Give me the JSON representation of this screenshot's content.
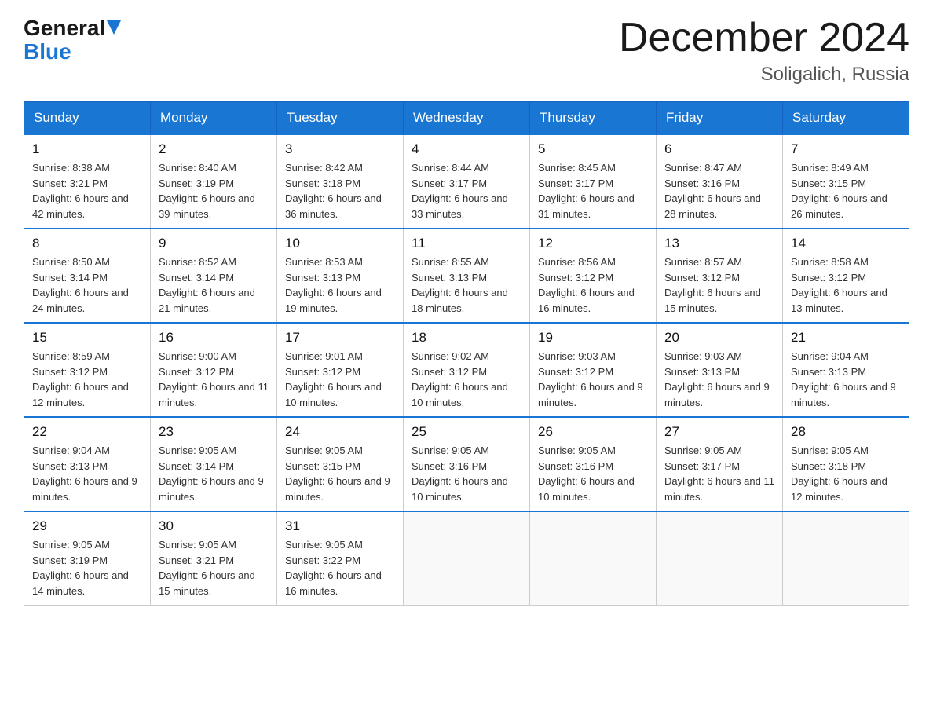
{
  "header": {
    "logo_general": "General",
    "logo_blue": "Blue",
    "month_title": "December 2024",
    "location": "Soligalich, Russia"
  },
  "days_of_week": [
    "Sunday",
    "Monday",
    "Tuesday",
    "Wednesday",
    "Thursday",
    "Friday",
    "Saturday"
  ],
  "weeks": [
    [
      {
        "day": "1",
        "sunrise": "Sunrise: 8:38 AM",
        "sunset": "Sunset: 3:21 PM",
        "daylight": "Daylight: 6 hours and 42 minutes."
      },
      {
        "day": "2",
        "sunrise": "Sunrise: 8:40 AM",
        "sunset": "Sunset: 3:19 PM",
        "daylight": "Daylight: 6 hours and 39 minutes."
      },
      {
        "day": "3",
        "sunrise": "Sunrise: 8:42 AM",
        "sunset": "Sunset: 3:18 PM",
        "daylight": "Daylight: 6 hours and 36 minutes."
      },
      {
        "day": "4",
        "sunrise": "Sunrise: 8:44 AM",
        "sunset": "Sunset: 3:17 PM",
        "daylight": "Daylight: 6 hours and 33 minutes."
      },
      {
        "day": "5",
        "sunrise": "Sunrise: 8:45 AM",
        "sunset": "Sunset: 3:17 PM",
        "daylight": "Daylight: 6 hours and 31 minutes."
      },
      {
        "day": "6",
        "sunrise": "Sunrise: 8:47 AM",
        "sunset": "Sunset: 3:16 PM",
        "daylight": "Daylight: 6 hours and 28 minutes."
      },
      {
        "day": "7",
        "sunrise": "Sunrise: 8:49 AM",
        "sunset": "Sunset: 3:15 PM",
        "daylight": "Daylight: 6 hours and 26 minutes."
      }
    ],
    [
      {
        "day": "8",
        "sunrise": "Sunrise: 8:50 AM",
        "sunset": "Sunset: 3:14 PM",
        "daylight": "Daylight: 6 hours and 24 minutes."
      },
      {
        "day": "9",
        "sunrise": "Sunrise: 8:52 AM",
        "sunset": "Sunset: 3:14 PM",
        "daylight": "Daylight: 6 hours and 21 minutes."
      },
      {
        "day": "10",
        "sunrise": "Sunrise: 8:53 AM",
        "sunset": "Sunset: 3:13 PM",
        "daylight": "Daylight: 6 hours and 19 minutes."
      },
      {
        "day": "11",
        "sunrise": "Sunrise: 8:55 AM",
        "sunset": "Sunset: 3:13 PM",
        "daylight": "Daylight: 6 hours and 18 minutes."
      },
      {
        "day": "12",
        "sunrise": "Sunrise: 8:56 AM",
        "sunset": "Sunset: 3:12 PM",
        "daylight": "Daylight: 6 hours and 16 minutes."
      },
      {
        "day": "13",
        "sunrise": "Sunrise: 8:57 AM",
        "sunset": "Sunset: 3:12 PM",
        "daylight": "Daylight: 6 hours and 15 minutes."
      },
      {
        "day": "14",
        "sunrise": "Sunrise: 8:58 AM",
        "sunset": "Sunset: 3:12 PM",
        "daylight": "Daylight: 6 hours and 13 minutes."
      }
    ],
    [
      {
        "day": "15",
        "sunrise": "Sunrise: 8:59 AM",
        "sunset": "Sunset: 3:12 PM",
        "daylight": "Daylight: 6 hours and 12 minutes."
      },
      {
        "day": "16",
        "sunrise": "Sunrise: 9:00 AM",
        "sunset": "Sunset: 3:12 PM",
        "daylight": "Daylight: 6 hours and 11 minutes."
      },
      {
        "day": "17",
        "sunrise": "Sunrise: 9:01 AM",
        "sunset": "Sunset: 3:12 PM",
        "daylight": "Daylight: 6 hours and 10 minutes."
      },
      {
        "day": "18",
        "sunrise": "Sunrise: 9:02 AM",
        "sunset": "Sunset: 3:12 PM",
        "daylight": "Daylight: 6 hours and 10 minutes."
      },
      {
        "day": "19",
        "sunrise": "Sunrise: 9:03 AM",
        "sunset": "Sunset: 3:12 PM",
        "daylight": "Daylight: 6 hours and 9 minutes."
      },
      {
        "day": "20",
        "sunrise": "Sunrise: 9:03 AM",
        "sunset": "Sunset: 3:13 PM",
        "daylight": "Daylight: 6 hours and 9 minutes."
      },
      {
        "day": "21",
        "sunrise": "Sunrise: 9:04 AM",
        "sunset": "Sunset: 3:13 PM",
        "daylight": "Daylight: 6 hours and 9 minutes."
      }
    ],
    [
      {
        "day": "22",
        "sunrise": "Sunrise: 9:04 AM",
        "sunset": "Sunset: 3:13 PM",
        "daylight": "Daylight: 6 hours and 9 minutes."
      },
      {
        "day": "23",
        "sunrise": "Sunrise: 9:05 AM",
        "sunset": "Sunset: 3:14 PM",
        "daylight": "Daylight: 6 hours and 9 minutes."
      },
      {
        "day": "24",
        "sunrise": "Sunrise: 9:05 AM",
        "sunset": "Sunset: 3:15 PM",
        "daylight": "Daylight: 6 hours and 9 minutes."
      },
      {
        "day": "25",
        "sunrise": "Sunrise: 9:05 AM",
        "sunset": "Sunset: 3:16 PM",
        "daylight": "Daylight: 6 hours and 10 minutes."
      },
      {
        "day": "26",
        "sunrise": "Sunrise: 9:05 AM",
        "sunset": "Sunset: 3:16 PM",
        "daylight": "Daylight: 6 hours and 10 minutes."
      },
      {
        "day": "27",
        "sunrise": "Sunrise: 9:05 AM",
        "sunset": "Sunset: 3:17 PM",
        "daylight": "Daylight: 6 hours and 11 minutes."
      },
      {
        "day": "28",
        "sunrise": "Sunrise: 9:05 AM",
        "sunset": "Sunset: 3:18 PM",
        "daylight": "Daylight: 6 hours and 12 minutes."
      }
    ],
    [
      {
        "day": "29",
        "sunrise": "Sunrise: 9:05 AM",
        "sunset": "Sunset: 3:19 PM",
        "daylight": "Daylight: 6 hours and 14 minutes."
      },
      {
        "day": "30",
        "sunrise": "Sunrise: 9:05 AM",
        "sunset": "Sunset: 3:21 PM",
        "daylight": "Daylight: 6 hours and 15 minutes."
      },
      {
        "day": "31",
        "sunrise": "Sunrise: 9:05 AM",
        "sunset": "Sunset: 3:22 PM",
        "daylight": "Daylight: 6 hours and 16 minutes."
      },
      null,
      null,
      null,
      null
    ]
  ]
}
